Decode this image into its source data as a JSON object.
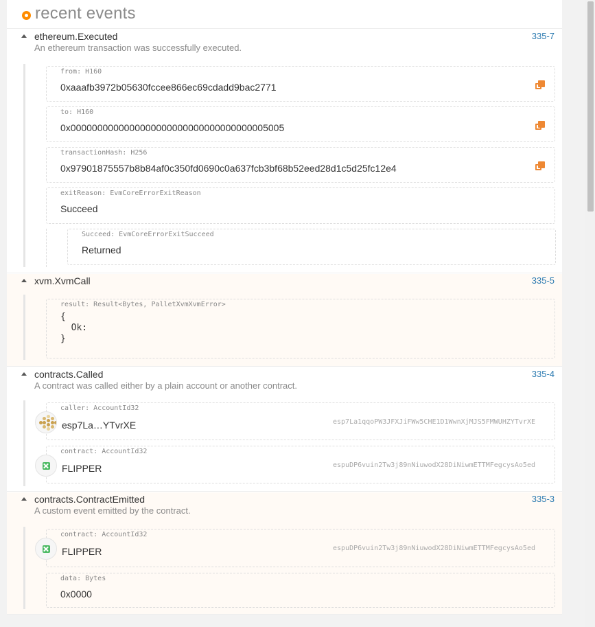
{
  "header": {
    "title": "recent events"
  },
  "events": [
    {
      "title": "ethereum.Executed",
      "description": "An ethereum transaction was successfully executed.",
      "id": "335-7",
      "fields": [
        {
          "label": "from: H160",
          "value": "0xaaafb3972b05630fccee866ec69cdadd9bac2771"
        },
        {
          "label": "to: H160",
          "value": "0x0000000000000000000000000000000000005005"
        },
        {
          "label": "transactionHash: H256",
          "value": "0x97901875557b8b84af0c350fd0690c0a637fcb3bf68b52eed28d1c5d25fc12e4"
        },
        {
          "label": "exitReason: EvmCoreErrorExitReason",
          "value": "Succeed"
        },
        {
          "label": "Succeed: EvmCoreErrorExitSucceed",
          "value": "Returned"
        }
      ]
    },
    {
      "title": "xvm.XvmCall",
      "id": "335-5",
      "fields": [
        {
          "label": "result: Result<Bytes, PalletXvmXvmError>",
          "value": "{\n  Ok:\n}"
        }
      ]
    },
    {
      "title": "contracts.Called",
      "description": "A contract was called either by a plain account or another contract.",
      "id": "335-4",
      "fields": [
        {
          "label": "caller: AccountId32",
          "value": "esp7La…YTvrXE",
          "address": "esp7La1qqoPW3JFXJiFWw5CHE1D1WwnXjMJS5FMWUHZYTvrXE"
        },
        {
          "label": "contract: AccountId32",
          "value": "FLIPPER",
          "address": "espuDP6vuin2Tw3j89nNiuwodX28DiNiwmETTMFegcysAo5ed"
        }
      ]
    },
    {
      "title": "contracts.ContractEmitted",
      "description": "A custom event emitted by the contract.",
      "id": "335-3",
      "fields": [
        {
          "label": "contract: AccountId32",
          "value": "FLIPPER",
          "address": "espuDP6vuin2Tw3j89nNiuwodX28DiNiwmETTMFegcysAo5ed"
        },
        {
          "label": "data: Bytes",
          "value": "0x0000"
        }
      ]
    }
  ],
  "colors": {
    "accent": "#ff8c00",
    "link": "#2b7ab0",
    "copy": "#ee8833",
    "identicon_green": "#4cba63",
    "identicon_gold": "#c9a04e"
  },
  "icons": [
    "orange-dot-icon",
    "expand-arrow-icon",
    "copy-icon",
    "identicon-icon"
  ]
}
